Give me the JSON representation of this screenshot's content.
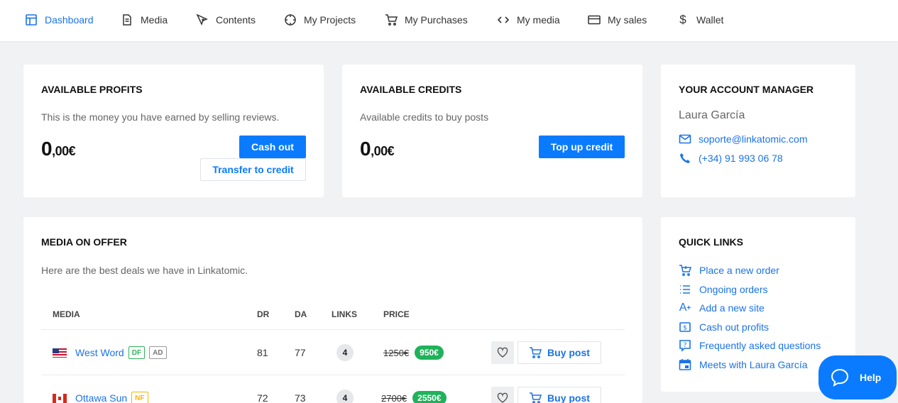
{
  "nav": {
    "items": [
      {
        "label": "Dashboard",
        "icon": "dashboard-icon",
        "active": true
      },
      {
        "label": "Media",
        "icon": "document-icon"
      },
      {
        "label": "Contents",
        "icon": "pen-tool-icon"
      },
      {
        "label": "My Projects",
        "icon": "compass-icon"
      },
      {
        "label": "My Purchases",
        "icon": "cart-icon"
      },
      {
        "label": "My media",
        "icon": "code-icon"
      },
      {
        "label": "My sales",
        "icon": "card-icon"
      },
      {
        "label": "Wallet",
        "icon": "dollar-icon"
      }
    ]
  },
  "profits": {
    "title": "AVAILABLE PROFITS",
    "subtitle": "This is the money you have earned by selling reviews.",
    "amount_int": "0",
    "amount_dec": ",00€",
    "cashout_label": "Cash out",
    "transfer_label": "Transfer to credit"
  },
  "credits": {
    "title": "AVAILABLE CREDITS",
    "subtitle": "Available credits to buy posts",
    "amount_int": "0",
    "amount_dec": ",00€",
    "topup_label": "Top up credit"
  },
  "manager": {
    "title": "YOUR ACCOUNT MANAGER",
    "name": "Laura García",
    "email": "soporte@linkatomic.com",
    "phone": "(+34) 91 993 06 78"
  },
  "offer": {
    "title": "MEDIA ON OFFER",
    "subtitle": "Here are the best deals we have in Linkatomic.",
    "columns": {
      "media": "MEDIA",
      "dr": "DR",
      "da": "DA",
      "links": "LINKS",
      "price": "PRICE"
    },
    "rows": [
      {
        "name": "West Word",
        "flag": "us",
        "tags": [
          "DF",
          "AD"
        ],
        "dr": "81",
        "da": "77",
        "links": "4",
        "old_price": "1250€",
        "new_price": "950€",
        "buy_label": "Buy post"
      },
      {
        "name": "Ottawa Sun",
        "flag": "ca",
        "tags": [
          "NF"
        ],
        "dr": "72",
        "da": "73",
        "links": "4",
        "old_price": "2700€",
        "new_price": "2550€",
        "buy_label": "Buy post"
      }
    ]
  },
  "quicklinks": {
    "title": "QUICK LINKS",
    "items": [
      {
        "label": "Place a new order",
        "icon": "cart-plus-icon"
      },
      {
        "label": "Ongoing orders",
        "icon": "list-icon"
      },
      {
        "label": "Add a new site",
        "icon": "text-add-icon"
      },
      {
        "label": "Cash out profits",
        "icon": "money-icon"
      },
      {
        "label": "Frequently asked questions",
        "icon": "question-icon"
      },
      {
        "label": "Meets with Laura García",
        "icon": "calendar-icon"
      }
    ]
  },
  "help": {
    "label": "Help"
  },
  "colors": {
    "accent": "#0a7bff",
    "link": "#1a73e8",
    "success": "#1fb25a",
    "nofollow": "#f6b400"
  }
}
